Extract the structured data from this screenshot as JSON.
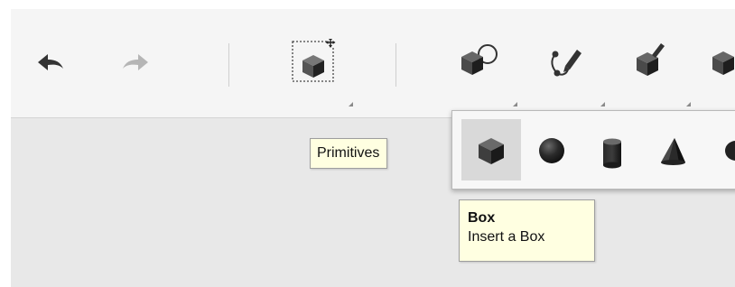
{
  "toolbar": {
    "buttons": [
      {
        "icon": "undo-arrow-icon"
      },
      {
        "icon": "redo-arrow-icon",
        "state": "disabled"
      },
      {
        "icon": "move-object-icon"
      },
      {
        "icon": "primitives-icon"
      },
      {
        "icon": "sketch-pen-icon"
      },
      {
        "icon": "modify-box-icon"
      },
      {
        "icon": "more-tools-icon"
      }
    ]
  },
  "tooltips": {
    "primitives": "Primitives",
    "box": {
      "title": "Box",
      "description": "Insert a Box"
    }
  },
  "primitives_menu": {
    "items": [
      {
        "icon": "box-icon",
        "label": "Box",
        "selected": true
      },
      {
        "icon": "sphere-icon",
        "label": "Sphere"
      },
      {
        "icon": "cylinder-icon",
        "label": "Cylinder"
      },
      {
        "icon": "cone-icon",
        "label": "Cone"
      },
      {
        "icon": "torus-icon",
        "label": "Torus"
      }
    ]
  },
  "colors": {
    "toolbar_bg": "#f5f5f5",
    "canvas_bg": "#e8e8e8",
    "icon_dark": "#333333",
    "icon_disabled": "#b5b5b5",
    "tooltip_bg": "#ffffe1",
    "selected_item_bg": "#d9d9d9"
  }
}
